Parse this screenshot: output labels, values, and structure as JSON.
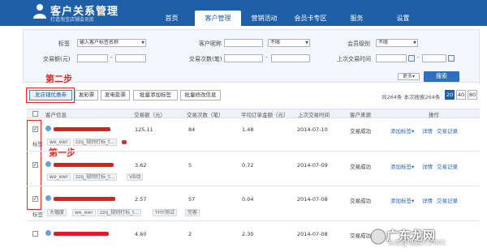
{
  "header": {
    "title": "客户关系管理",
    "subtitle": "打造淘宝店铺会员库",
    "nav": [
      "首页",
      "客户管理",
      "营销活动",
      "会员卡专区",
      "服务",
      "设置"
    ],
    "active_index": 1,
    "brand_color": "#1e5fa8"
  },
  "filters": {
    "tag_label": "标签",
    "tag_select": "输入客户标签名称",
    "nickname_label": "客户昵称",
    "nickname_select": "不限",
    "level_label": "会员级别",
    "level_select": "不限",
    "amount_label": "交易额(元)",
    "count_label": "交易次数(笔)",
    "last_trade_label": "上次交易时间",
    "dash": "-",
    "more_label": "更多",
    "search_label": "搜索"
  },
  "annotations": {
    "step2": "第二步",
    "step1": "第一步"
  },
  "toolbar": {
    "send_coupon": "发店铺优惠券",
    "send_color": "发彩票",
    "send_movie": "发电影票",
    "batch_tag": "批量添加标签",
    "batch_edit": "批量修改信息",
    "total_text": "共264条 本次搜索264条",
    "page_sizes": [
      "20",
      "40",
      "80"
    ],
    "page_size_active": "20"
  },
  "table": {
    "headers": [
      "客户信息",
      "交易额（元）",
      "交易次数（笔）",
      "平均订单金额（元）",
      "上次交易时间",
      "客户来源",
      "操作"
    ],
    "tag_label": "标签",
    "add_tag": "添加标签",
    "detail": "详情",
    "record": "交易记录",
    "rows": [
      {
        "amount": "125.11",
        "count": "84",
        "avg": "1.48",
        "date": "2014-07-10",
        "source": "交易成功",
        "checked": true,
        "tags": [
          "we_ewr",
          "zzq_规则打标_t...",
          ""
        ]
      },
      {
        "amount": "3.62",
        "count": "5",
        "avg": "0.72",
        "date": "2014-07-09",
        "source": "交易成功",
        "checked": true,
        "tags": [
          "we_ewr",
          "zzq_规则打标_t...",
          "VB动"
        ]
      },
      {
        "amount": "2.57",
        "count": "57",
        "avg": "0.04",
        "date": "2014-07-08",
        "source": "交易成功",
        "checked": true,
        "tags": [
          "大幅度",
          "we_ewr",
          "zzq_规则打标_t...",
          "YHY测试",
          "完客"
        ]
      },
      {
        "amount": "4.60",
        "count": "2",
        "avg": "2.30",
        "date": "2014-07-08",
        "source": "交易成功",
        "checked": false,
        "tags": []
      }
    ]
  },
  "watermark": {
    "text": "广东龙网",
    "sub": "头条@电脑大学001"
  }
}
